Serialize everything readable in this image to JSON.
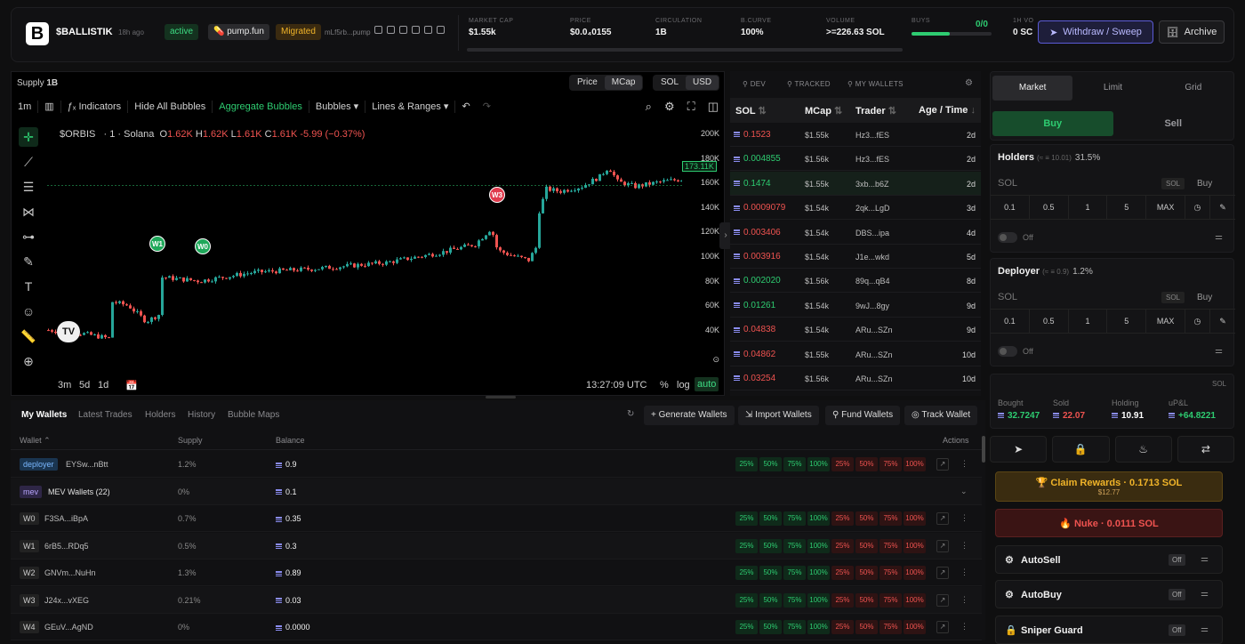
{
  "header": {
    "logo_letter": "B",
    "name": "$BALLISTIK",
    "age": "18h ago",
    "status": "active",
    "platform": "pump.fun",
    "migrated": "Migrated",
    "address": "mLf5rb...pump",
    "stats": [
      {
        "label": "MARKET CAP",
        "value": "$1.55k"
      },
      {
        "label": "PRICE",
        "value": "$0.0₄0155"
      },
      {
        "label": "CIRCULATION",
        "value": "1B"
      },
      {
        "label": "B.CURVE",
        "value": "100%"
      },
      {
        "label": "VOLUME",
        "value": ">=226.63 SOL"
      }
    ],
    "buys_label": "BUYS",
    "buys_value": "0/0",
    "buys_fill": 0.48,
    "vol_label": "1H VO",
    "vol_value": "0 SC",
    "withdraw_label": "Withdraw / Sweep",
    "archive_label": "Archive"
  },
  "chart": {
    "supply_label": "Supply",
    "supply_value": "1B",
    "price_toggle": [
      "Price",
      "MCap"
    ],
    "currency_toggle": [
      "SOL",
      "USD"
    ],
    "toolbar": [
      "1m",
      "Indicators",
      "Hide All Bubbles",
      "Aggregate Bubbles",
      "Bubbles ▾",
      "Lines & Ranges ▾"
    ],
    "legend_symbol": "$ORBIS",
    "legend_interval": "· 1 · Solana",
    "ohlc": {
      "o_label": "O",
      "o": "1.62K",
      "h_label": "H",
      "h": "1.62K",
      "l_label": "L",
      "l": "1.61K",
      "c_label": "C",
      "c": "1.61K",
      "chg": "-5.99 (−0.37%)"
    },
    "y_ticks": [
      "200K",
      "180K",
      "160K",
      "140K",
      "120K",
      "100K",
      "80K",
      "60K",
      "40K"
    ],
    "last_price": "173.11K",
    "bubbles": [
      {
        "label": "W1",
        "type": "green"
      },
      {
        "label": "W0",
        "type": "green"
      },
      {
        "label": "W3",
        "type": "red"
      }
    ],
    "ranges": [
      "3m",
      "5d",
      "1d"
    ],
    "time": "13:27:09 UTC",
    "pct": "%",
    "log": "log",
    "auto": "auto"
  },
  "trades": {
    "tabs": [
      "DEV",
      "TRACKED",
      "MY WALLETS"
    ],
    "headers": [
      "SOL",
      "MCap",
      "Trader",
      "Age / Time"
    ],
    "rows": [
      {
        "sol": "0.1523",
        "side": "sell",
        "mcap": "$1.55k",
        "trader": "Hz3...fES",
        "age": "2d"
      },
      {
        "sol": "0.004855",
        "side": "buy",
        "mcap": "$1.56k",
        "trader": "Hz3...fES",
        "age": "2d"
      },
      {
        "sol": "0.1474",
        "side": "buy",
        "mcap": "$1.55k",
        "trader": "3xb...b6Z",
        "age": "2d"
      },
      {
        "sol": "0.0009079",
        "side": "sell",
        "mcap": "$1.54k",
        "trader": "2qk...LgD",
        "age": "3d"
      },
      {
        "sol": "0.003406",
        "side": "sell",
        "mcap": "$1.54k",
        "trader": "DBS...ipa",
        "age": "4d"
      },
      {
        "sol": "0.003916",
        "side": "sell",
        "mcap": "$1.54k",
        "trader": "J1e...wkd",
        "age": "5d"
      },
      {
        "sol": "0.002020",
        "side": "buy",
        "mcap": "$1.56k",
        "trader": "89q...qB4",
        "age": "8d"
      },
      {
        "sol": "0.01261",
        "side": "buy",
        "mcap": "$1.54k",
        "trader": "9wJ...8gy",
        "age": "9d"
      },
      {
        "sol": "0.04838",
        "side": "sell",
        "mcap": "$1.54k",
        "trader": "ARu...SZn",
        "age": "9d"
      },
      {
        "sol": "0.04862",
        "side": "sell",
        "mcap": "$1.55k",
        "trader": "ARu...SZn",
        "age": "10d"
      },
      {
        "sol": "0.03254",
        "side": "sell",
        "mcap": "$1.56k",
        "trader": "ARu...SZn",
        "age": "10d"
      }
    ]
  },
  "order": {
    "tabs": [
      "Market",
      "Limit",
      "Grid"
    ],
    "buy": "Buy",
    "sell": "Sell",
    "holders": {
      "title": "Holders",
      "sub": "(≈ ≡ 10.01)",
      "pct": "31.5%"
    },
    "deployer": {
      "title": "Deployer",
      "sub": "(≈ ≡ 0.9)",
      "pct": "1.2%"
    },
    "input_label": "SOL",
    "sol_btn": "SOL",
    "buy_btn": "Buy",
    "quick": [
      "0.1",
      "0.5",
      "1",
      "5",
      "MAX"
    ],
    "off": "Off",
    "pnl_unit": "SOL",
    "pnl": [
      {
        "label": "Bought",
        "value": "32.7247"
      },
      {
        "label": "Sold",
        "value": "22.07"
      },
      {
        "label": "Holding",
        "value": "10.91"
      },
      {
        "label": "uP&L",
        "value": "+64.8221"
      }
    ],
    "claim": "Claim Rewards · 0.1713 SOL",
    "claim_sub": "$12.77",
    "nuke": "Nuke · 0.0111 SOL",
    "autos": [
      {
        "label": "AutoSell",
        "state": "Off"
      },
      {
        "label": "AutoBuy",
        "state": "Off"
      },
      {
        "label": "Sniper Guard",
        "state": "Off"
      }
    ]
  },
  "wallets": {
    "tabs": [
      "My Wallets",
      "Latest Trades",
      "Holders",
      "History",
      "Bubble Maps"
    ],
    "buttons": [
      "Generate Wallets",
      "Import Wallets",
      "Fund Wallets",
      "Track Wallet"
    ],
    "headers": [
      "Wallet ⌃",
      "Supply",
      "Balance",
      "Actions"
    ],
    "pct_buy": [
      "25%",
      "50%",
      "75%",
      "100%"
    ],
    "pct_sell": [
      "25%",
      "50%",
      "75%",
      "100%"
    ],
    "rows": [
      {
        "tag": "deployer",
        "addr": "EYSw...nBtt",
        "supply": "1.2%",
        "balance": "0.9",
        "actions": true
      },
      {
        "tag": "mev",
        "addr": "MEV Wallets (22)",
        "supply": "0%",
        "balance": "0.1",
        "actions": false
      },
      {
        "tag": "W0",
        "addr": "F3SA...iBpA",
        "supply": "0.7%",
        "balance": "0.35",
        "actions": true
      },
      {
        "tag": "W1",
        "addr": "6rB5...RDq5",
        "supply": "0.5%",
        "balance": "0.3",
        "actions": true
      },
      {
        "tag": "W2",
        "addr": "GNVm...NuHn",
        "supply": "1.3%",
        "balance": "0.89",
        "actions": true
      },
      {
        "tag": "W3",
        "addr": "J24x...vXEG",
        "supply": "0.21%",
        "balance": "0.03",
        "actions": true
      },
      {
        "tag": "W4",
        "addr": "GEuV...AgND",
        "supply": "0%",
        "balance": "0.0000",
        "actions": true
      }
    ]
  },
  "colors": {
    "green": "#2ecc71",
    "red": "#ef5350",
    "accent": "#5b5bd6",
    "gold": "#f0b429"
  }
}
